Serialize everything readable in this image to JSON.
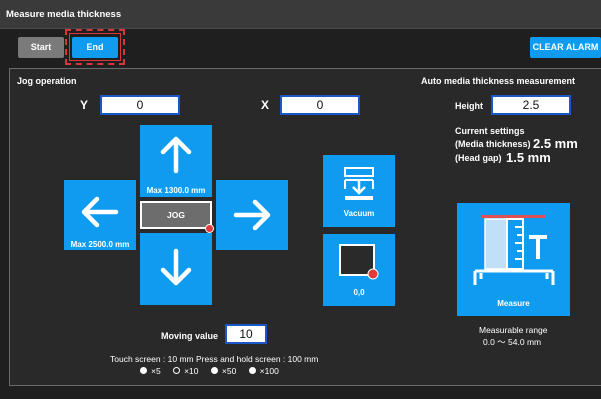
{
  "window": {
    "title": "Measure media thickness"
  },
  "toolbar": {
    "start_label": "Start",
    "end_label": "End",
    "clear_alarm_label": "CLEAR ALARM"
  },
  "jog": {
    "title": "Jog operation",
    "y_label": "Y",
    "y_value": "0",
    "x_label": "X",
    "x_value": "0",
    "up_caption": "Max 1300.0 mm",
    "left_caption": "Max 2500.0 mm",
    "center_label": "JOG",
    "vacuum_label": "Vacuum",
    "origin_label": "0,0",
    "moving_value_label": "Moving value",
    "moving_value": "10",
    "hint": "Touch screen : 10 mm   Press and hold screen : 100 mm",
    "multipliers": [
      "×5",
      "×10",
      "×50",
      "×100"
    ],
    "selected_multiplier": "×10"
  },
  "auto": {
    "title": "Auto media thickness measurement",
    "height_label": "Height",
    "height_value": "2.5",
    "current_settings_label": "Current settings",
    "media_thickness_label": "(Media thickness)",
    "media_thickness_value": "2.5 mm",
    "head_gap_label": "(Head gap)",
    "head_gap_value": "1.5 mm",
    "measure_label": "Measure",
    "range_label": "Measurable range",
    "range_value": "0.0 ～ 54.0 mm"
  },
  "icons": [
    "arrow-up-icon",
    "arrow-down-icon",
    "arrow-left-icon",
    "arrow-right-icon",
    "vacuum-icon",
    "origin-icon",
    "measure-gauge-icon"
  ],
  "colors": {
    "accent": "#0f9cf0",
    "highlight": "#d9353d",
    "background": "#1f1f1f"
  }
}
